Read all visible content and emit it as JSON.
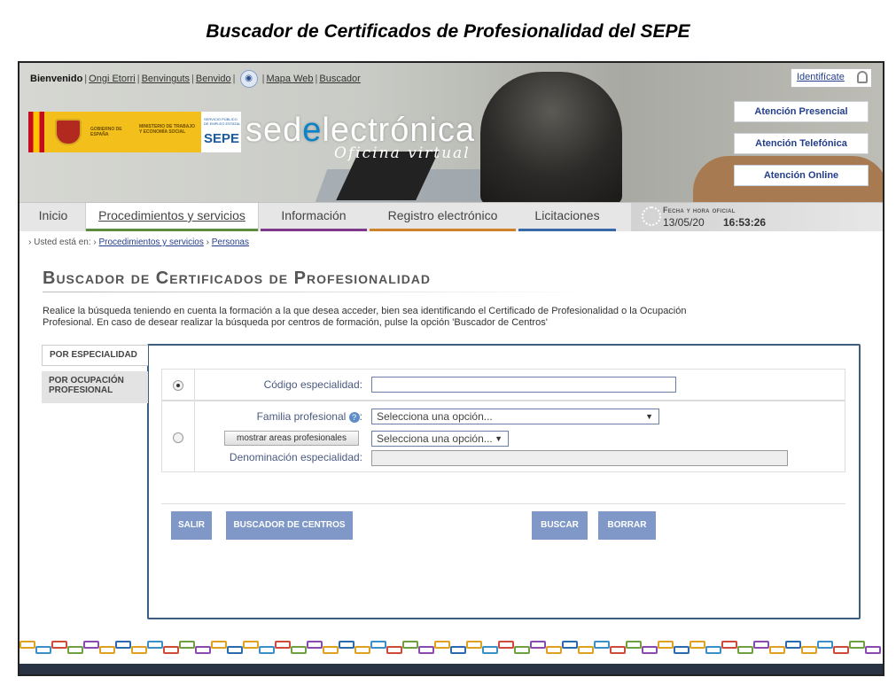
{
  "slide_title": "Buscador de Certificados de Profesionalidad del SEPE",
  "topbar": {
    "welcome": "Bienvenido",
    "links": [
      "Ongi Etorri",
      "Benvinguts",
      "Benvido"
    ],
    "map": "Mapa Web",
    "search": "Buscador",
    "login": "Identifícate"
  },
  "logos": {
    "gov1": "GOBIERNO DE ESPAÑA",
    "gov2": "MINISTERIO DE TRABAJO Y ECONOMÍA SOCIAL",
    "sepe_small": "SERVICIO PÚBLICO DE EMPLEO ESTATAL",
    "sepe": "SEPE",
    "sede_a": "sed",
    "sede_b": "e",
    "sede_c": "lectrónica",
    "oficina": "Oficina virtual"
  },
  "attention": [
    "Atención Presencial",
    "Atención Telefónica",
    "Atención Online"
  ],
  "nav": {
    "tabs": [
      "Inicio",
      "Procedimientos y servicios",
      "Información",
      "Registro electrónico",
      "Licitaciones"
    ],
    "date_label": "Fecha y hora oficial",
    "date": "13/05/20",
    "time": "16:53:26"
  },
  "breadcrumb": {
    "prefix": "Usted está en:",
    "items": [
      "Procedimientos y servicios",
      "Personas"
    ]
  },
  "page_title": "Buscador de Certificados de Profesionalidad",
  "intro": "Realice la búsqueda teniendo en cuenta la formación a la que desea acceder, bien sea identificando el Certificado de Profesionalidad o la Ocupación Profesional. En caso de desear realizar la búsqueda por centros de formación, pulse la opción 'Buscador de Centros'",
  "side_tabs": [
    "POR ESPECIALIDAD",
    "POR OCUPACIÓN PROFESIONAL"
  ],
  "form": {
    "codigo_label": "Código especialidad:",
    "codigo_value": "",
    "familia_label": "Familia profesional",
    "familia_colon": ":",
    "select_placeholder": "Selecciona una opción...",
    "areas_button": "mostrar areas profesionales",
    "denominacion_label": "Denominación especialidad:",
    "help": "?"
  },
  "buttons": [
    "SALIR",
    "BUSCADOR DE CENTROS",
    "BUSCAR",
    "BORRAR"
  ]
}
